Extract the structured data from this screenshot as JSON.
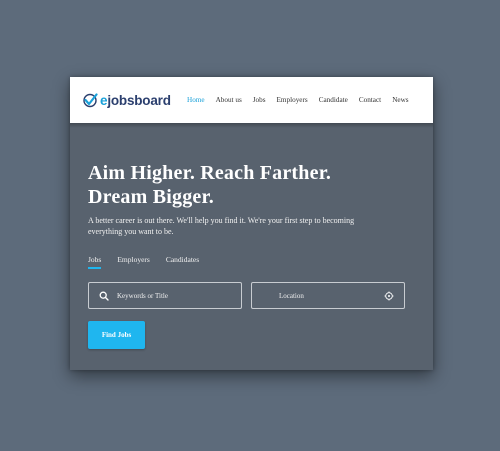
{
  "brand": {
    "logo_prefix": "e",
    "logo_rest": "jobsboard"
  },
  "nav": {
    "items": [
      {
        "label": "Home",
        "active": true
      },
      {
        "label": "About us"
      },
      {
        "label": "Jobs"
      },
      {
        "label": "Employers"
      },
      {
        "label": "Candidate"
      },
      {
        "label": "Contact"
      },
      {
        "label": "News"
      }
    ]
  },
  "hero": {
    "title_line1": "Aim Higher. Reach Farther.",
    "title_line2": "Dream Bigger.",
    "subtitle": "A better career is out there. We'll help you find it. We're your first step to becoming everything you want to be."
  },
  "search": {
    "tabs": [
      {
        "label": "Jobs",
        "active": true
      },
      {
        "label": "Employers"
      },
      {
        "label": "Candidates"
      }
    ],
    "keyword_placeholder": "Keywords or Title",
    "location_placeholder": "Location",
    "button_label": "Find Jobs"
  },
  "icons": {
    "keyword": "search-icon",
    "location": "crosshair-icon",
    "logo_mark": "checkmark-icon"
  },
  "colors": {
    "accent": "#1fb6ef",
    "brand_dark": "#2b3f6e",
    "hero_bg": "#58626e",
    "page_bg": "#5d6b7b"
  }
}
